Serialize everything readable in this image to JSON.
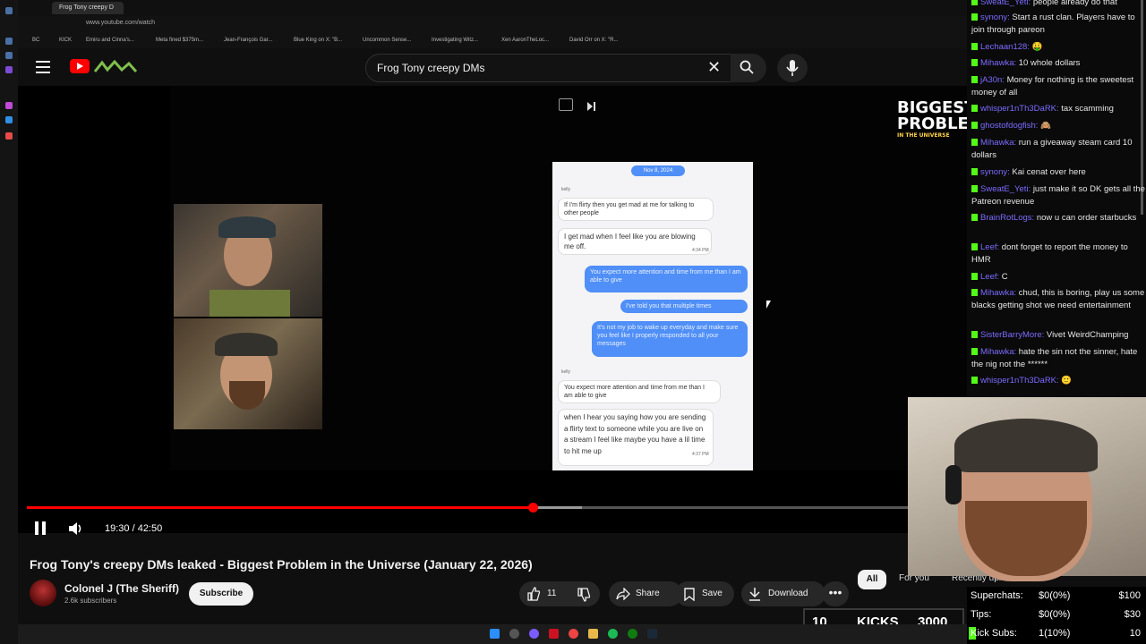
{
  "browser": {
    "tab_title": "Frog Tony creepy D",
    "url": "www.youtube.com/watch",
    "bookmarks": [
      "BC",
      "KICK",
      "Emiru and Cinna's...",
      "Meta fined $375m...",
      "Jean-François Gar...",
      "Blue King on X: \"B...",
      "Uncommon Sense...",
      "Investigating Witz...",
      "Xen AaronTheLoc...",
      "David Orr on X: \"R..."
    ]
  },
  "search": {
    "query": "Frog Tony creepy DMs"
  },
  "overlay": {
    "logo_line1": "BIGGEST",
    "logo_line2": "PROBLEM",
    "logo_sub": "IN THE UNIVERSE"
  },
  "dm": {
    "date": "Nov 8, 2024",
    "sender": "kelly",
    "messages": [
      "If I'm flirty then you get mad at me for talking to other people",
      "I get mad when I feel like you are blowing me off.",
      "You expect more attention and time from me than I am able to give",
      "I've told you that multiple times",
      "It's not my job to wake up everyday and make sure you feel like I properly responded to all your messages",
      "You expect more attention and time from me than I am able to give",
      "when I hear you saying how you are sending a flirty text to someone while you are live on a stream I feel like maybe you have a lil time to hit me up"
    ],
    "times": [
      "4:34 PM",
      "4:37 PM",
      "4:37 PM"
    ]
  },
  "player": {
    "time": "19:30 / 42:50",
    "progress": 0.574,
    "buffered": 0.63
  },
  "video": {
    "title": "Frog Tony's creepy DMs leaked - Biggest Problem in the Universe (January 22, 2026)",
    "channel": "Colonel J (The Sheriff)",
    "subscribers": "2.6k subscribers",
    "subscribe": "Subscribe",
    "likes": "11",
    "share": "Share",
    "save": "Save",
    "download": "Download"
  },
  "chips": [
    "All",
    "For you",
    "Recently uploaded"
  ],
  "chat": [
    {
      "user": "SweatE_Yeti:",
      "text": "people already do that"
    },
    {
      "user": "synony:",
      "text": "Start a rust clan. Players have to join through pareon"
    },
    {
      "user": "Lechaan128:",
      "text": "🤑"
    },
    {
      "user": "Mihawka:",
      "text": "10 whole dollars"
    },
    {
      "user": "jA30n:",
      "text": "Money for nothing is the sweetest money of all"
    },
    {
      "user": "whisper1nTh3DaRK:",
      "text": "tax scamming"
    },
    {
      "user": "ghostofdogfish:",
      "text": "🙈"
    },
    {
      "user": "Mihawka:",
      "text": "run a giveaway steam card 10 dollars"
    },
    {
      "user": "synony:",
      "text": "Kai cenat over here"
    },
    {
      "user": "SweatE_Yeti:",
      "text": "just make it so DK gets all the Patreon revenue"
    },
    {
      "user": "BrainRotLogs:",
      "text": "now u can order starbucks"
    },
    {
      "user": "Leef:",
      "text": "dont forget to report the money to HMR"
    },
    {
      "user": "Leef:",
      "text": "C"
    },
    {
      "user": "Mihawka:",
      "text": "chud, this is boring, play us some blacks getting shot we need entertainment"
    },
    {
      "user": "SisterBarryMore:",
      "text": "Vivet WeirdChamping"
    },
    {
      "user": "Mihawka:",
      "text": "hate the sin not the sinner, hate the nig not the ******"
    },
    {
      "user": "whisper1nTh3DaRK:",
      "text": "🙂"
    }
  ],
  "stats": {
    "superchats_label": "Superchats:",
    "superchats_value": "$0(0%)",
    "superchats_goal": "$100",
    "tips_label": "Tips:",
    "tips_value": "$0(0%)",
    "tips_goal": "$30",
    "kicksubs_label": "Kick Subs:",
    "kicksubs_value": "1(10%)",
    "kicksubs_goal": "10"
  },
  "kicks": {
    "count": "10",
    "label": "KICKS",
    "goal": "3000"
  },
  "colors": {
    "accent": "#ff0000",
    "kick_green": "#53fc18",
    "imessage_blue": "#4f8ff7"
  }
}
